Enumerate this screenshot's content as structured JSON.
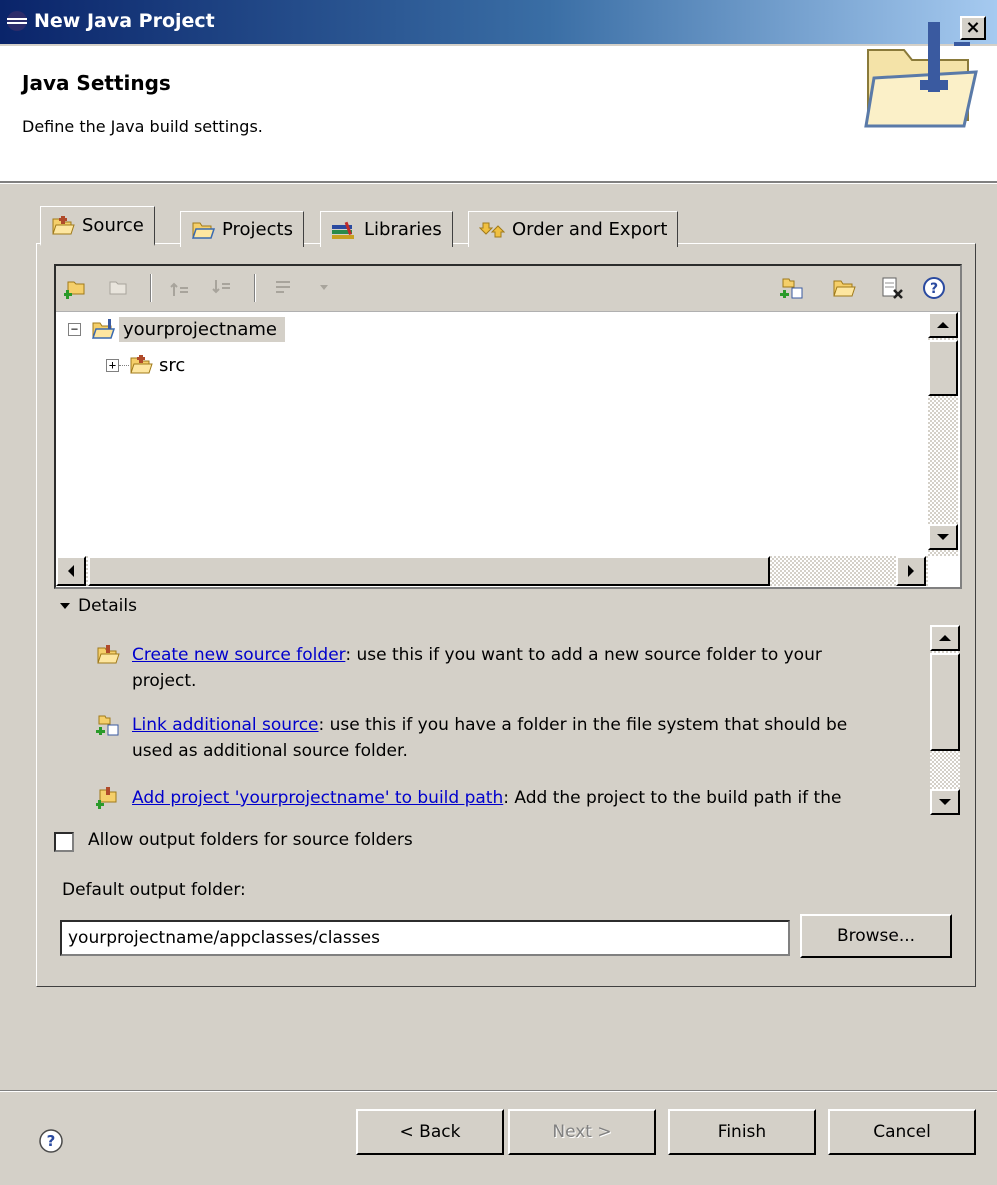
{
  "window": {
    "title": "New Java Project",
    "close_label": "×"
  },
  "header": {
    "title": "Java Settings",
    "description": "Define the Java build settings."
  },
  "tabs": [
    {
      "label": "Source",
      "icon": "source-folder-icon",
      "active": true
    },
    {
      "label": "Projects",
      "icon": "projects-folder-icon",
      "active": false
    },
    {
      "label": "Libraries",
      "icon": "libraries-icon",
      "active": false
    },
    {
      "label": "Order and Export",
      "icon": "order-export-icon",
      "active": false
    }
  ],
  "tree": {
    "root": {
      "label": "yourprojectname",
      "expander": "−",
      "icon": "java-project-icon"
    },
    "children": [
      {
        "label": "src",
        "expander": "+",
        "icon": "package-folder-icon"
      }
    ]
  },
  "details": {
    "toggle_label": "Details",
    "items": [
      {
        "link": "Create new source folder",
        "text": ": use this if you want to add a new source folder to your",
        "text2": "project."
      },
      {
        "link": "Link additional source",
        "text": ": use this if you have a folder in the file system that should be",
        "text2": "used as additional source folder."
      },
      {
        "link": "Add project 'yourprojectname' to build path",
        "text": ": Add the project to the build path if the",
        "text2": ""
      }
    ]
  },
  "output": {
    "allow_label": "Allow output folders for source folders",
    "allow_checked": false,
    "default_label": "Default output folder:",
    "value": "yourprojectname/appclasses/classes",
    "browse_label": "Browse..."
  },
  "buttons": {
    "help_icon": "help-icon",
    "back": "< Back",
    "next": "Next >",
    "finish": "Finish",
    "cancel": "Cancel"
  },
  "colors": {
    "titlebar_start": "#0a246a",
    "titlebar_end": "#a6caf0",
    "face": "#d4d0c8",
    "link": "#0000cc"
  }
}
